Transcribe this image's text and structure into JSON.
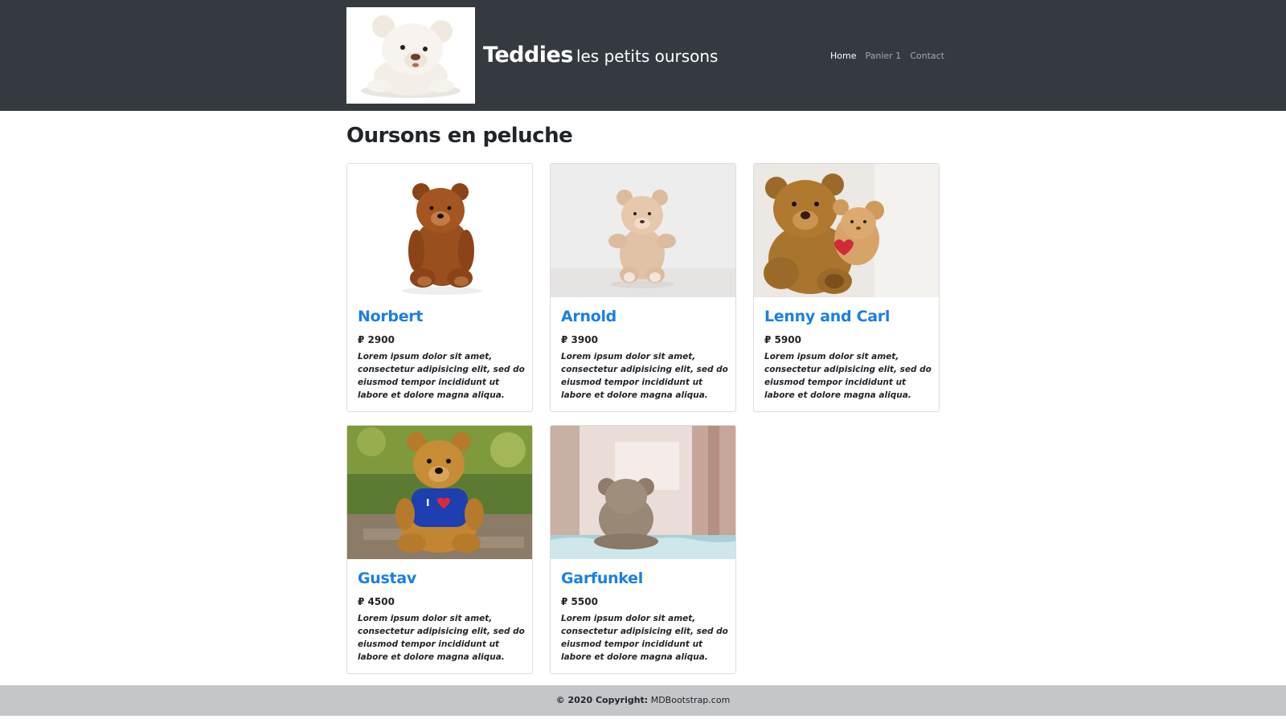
{
  "navbar": {
    "brand_strong": "Teddies",
    "brand_sub": "les petits oursons",
    "links": [
      {
        "label": "Home",
        "active": true
      },
      {
        "label": "Panier 1",
        "active": false
      },
      {
        "label": "Contact",
        "active": false
      }
    ]
  },
  "main": {
    "title": "Oursons en peluche",
    "products": [
      {
        "name": "Norbert",
        "price": "₽ 2900",
        "description": "Lorem ipsum dolor sit amet, consectetur adipisicing elit, sed do eiusmod tempor incididunt ut labore et dolore magna aliqua."
      },
      {
        "name": "Arnold",
        "price": "₽ 3900",
        "description": "Lorem ipsum dolor sit amet, consectetur adipisicing elit, sed do eiusmod tempor incididunt ut labore et dolore magna aliqua."
      },
      {
        "name": "Lenny and Carl",
        "price": "₽ 5900",
        "description": "Lorem ipsum dolor sit amet, consectetur adipisicing elit, sed do eiusmod tempor incididunt ut labore et dolore magna aliqua."
      },
      {
        "name": "Gustav",
        "price": "₽ 4500",
        "description": "Lorem ipsum dolor sit amet, consectetur adipisicing elit, sed do eiusmod tempor incididunt ut labore et dolore magna aliqua."
      },
      {
        "name": "Garfunkel",
        "price": "₽ 5500",
        "description": "Lorem ipsum dolor sit amet, consectetur adipisicing elit, sed do eiusmod tempor incididunt ut labore et dolore magna aliqua."
      }
    ]
  },
  "footer": {
    "copyright": "© 2020 Copyright:",
    "link": "MDBootstrap.com"
  },
  "colors": {
    "navbar_bg": "#343a40",
    "link_blue": "#1a7fe6",
    "footer_bg": "#c4c6c9"
  }
}
